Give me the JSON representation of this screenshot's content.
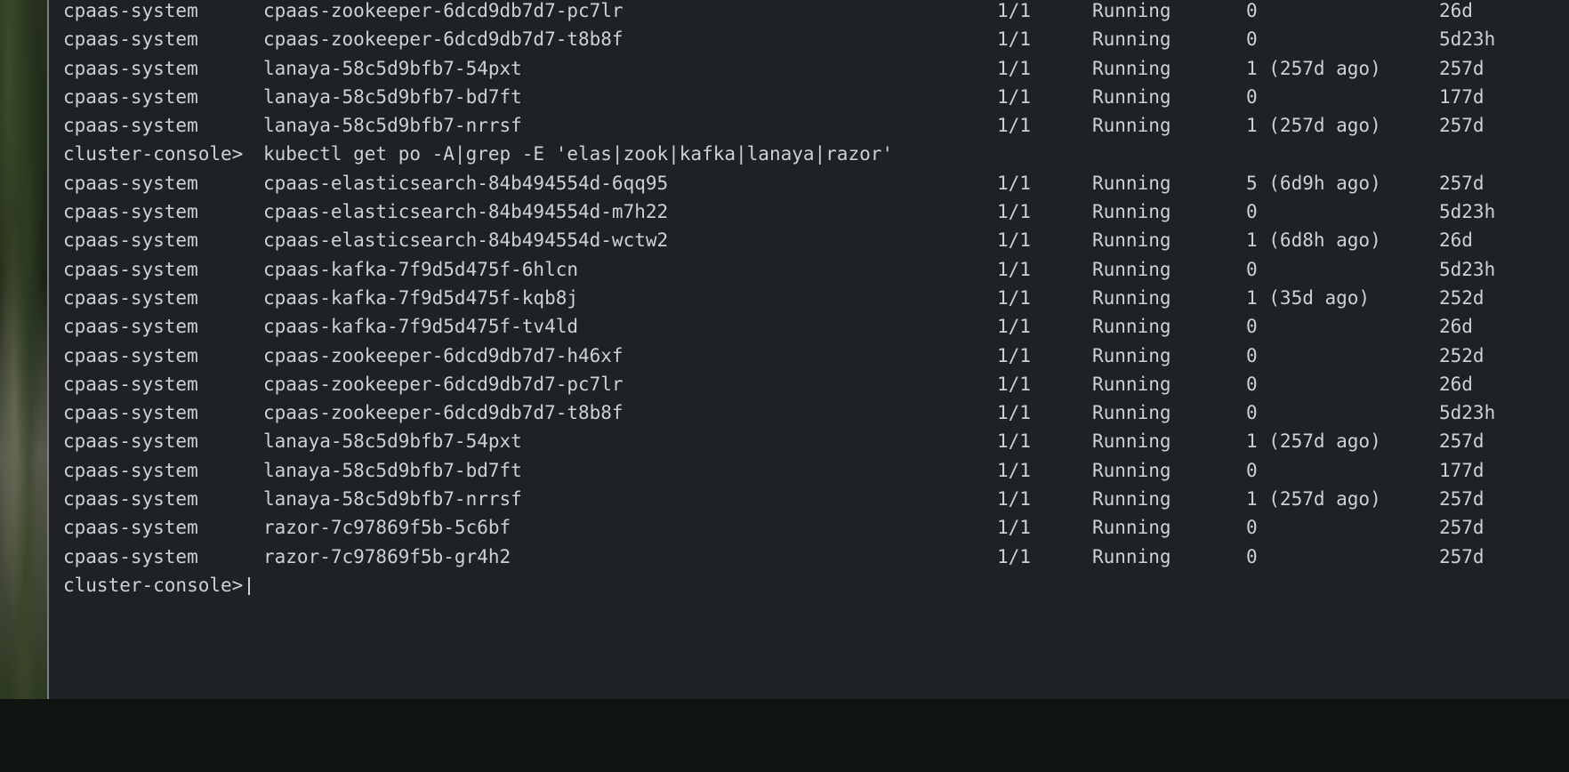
{
  "terminal": {
    "prompt": "cluster-console>",
    "command": "kubectl get po -A|grep -E 'elas|zook|kafka|lanaya|razor'",
    "previous_rows": [
      {
        "namespace": "cpaas-system",
        "name": "cpaas-zookeeper-6dcd9db7d7-pc7lr",
        "ready": "1/1",
        "status": "Running",
        "restarts": "0",
        "age": "26d"
      },
      {
        "namespace": "cpaas-system",
        "name": "cpaas-zookeeper-6dcd9db7d7-t8b8f",
        "ready": "1/1",
        "status": "Running",
        "restarts": "0",
        "age": "5d23h"
      },
      {
        "namespace": "cpaas-system",
        "name": "lanaya-58c5d9bfb7-54pxt",
        "ready": "1/1",
        "status": "Running",
        "restarts": "1 (257d ago)",
        "age": "257d"
      },
      {
        "namespace": "cpaas-system",
        "name": "lanaya-58c5d9bfb7-bd7ft",
        "ready": "1/1",
        "status": "Running",
        "restarts": "0",
        "age": "177d"
      },
      {
        "namespace": "cpaas-system",
        "name": "lanaya-58c5d9bfb7-nrrsf",
        "ready": "1/1",
        "status": "Running",
        "restarts": "1 (257d ago)",
        "age": "257d"
      }
    ],
    "rows": [
      {
        "namespace": "cpaas-system",
        "name": "cpaas-elasticsearch-84b494554d-6qq95",
        "ready": "1/1",
        "status": "Running",
        "restarts": "5 (6d9h ago)",
        "age": "257d"
      },
      {
        "namespace": "cpaas-system",
        "name": "cpaas-elasticsearch-84b494554d-m7h22",
        "ready": "1/1",
        "status": "Running",
        "restarts": "0",
        "age": "5d23h"
      },
      {
        "namespace": "cpaas-system",
        "name": "cpaas-elasticsearch-84b494554d-wctw2",
        "ready": "1/1",
        "status": "Running",
        "restarts": "1 (6d8h ago)",
        "age": "26d"
      },
      {
        "namespace": "cpaas-system",
        "name": "cpaas-kafka-7f9d5d475f-6hlcn",
        "ready": "1/1",
        "status": "Running",
        "restarts": "0",
        "age": "5d23h"
      },
      {
        "namespace": "cpaas-system",
        "name": "cpaas-kafka-7f9d5d475f-kqb8j",
        "ready": "1/1",
        "status": "Running",
        "restarts": "1 (35d ago)",
        "age": "252d"
      },
      {
        "namespace": "cpaas-system",
        "name": "cpaas-kafka-7f9d5d475f-tv4ld",
        "ready": "1/1",
        "status": "Running",
        "restarts": "0",
        "age": "26d"
      },
      {
        "namespace": "cpaas-system",
        "name": "cpaas-zookeeper-6dcd9db7d7-h46xf",
        "ready": "1/1",
        "status": "Running",
        "restarts": "0",
        "age": "252d"
      },
      {
        "namespace": "cpaas-system",
        "name": "cpaas-zookeeper-6dcd9db7d7-pc7lr",
        "ready": "1/1",
        "status": "Running",
        "restarts": "0",
        "age": "26d"
      },
      {
        "namespace": "cpaas-system",
        "name": "cpaas-zookeeper-6dcd9db7d7-t8b8f",
        "ready": "1/1",
        "status": "Running",
        "restarts": "0",
        "age": "5d23h"
      },
      {
        "namespace": "cpaas-system",
        "name": "lanaya-58c5d9bfb7-54pxt",
        "ready": "1/1",
        "status": "Running",
        "restarts": "1 (257d ago)",
        "age": "257d"
      },
      {
        "namespace": "cpaas-system",
        "name": "lanaya-58c5d9bfb7-bd7ft",
        "ready": "1/1",
        "status": "Running",
        "restarts": "0",
        "age": "177d"
      },
      {
        "namespace": "cpaas-system",
        "name": "lanaya-58c5d9bfb7-nrrsf",
        "ready": "1/1",
        "status": "Running",
        "restarts": "1 (257d ago)",
        "age": "257d"
      },
      {
        "namespace": "cpaas-system",
        "name": "razor-7c97869f5b-5c6bf",
        "ready": "1/1",
        "status": "Running",
        "restarts": "0",
        "age": "257d"
      },
      {
        "namespace": "cpaas-system",
        "name": "razor-7c97869f5b-gr4h2",
        "ready": "1/1",
        "status": "Running",
        "restarts": "0",
        "age": "257d"
      }
    ]
  }
}
